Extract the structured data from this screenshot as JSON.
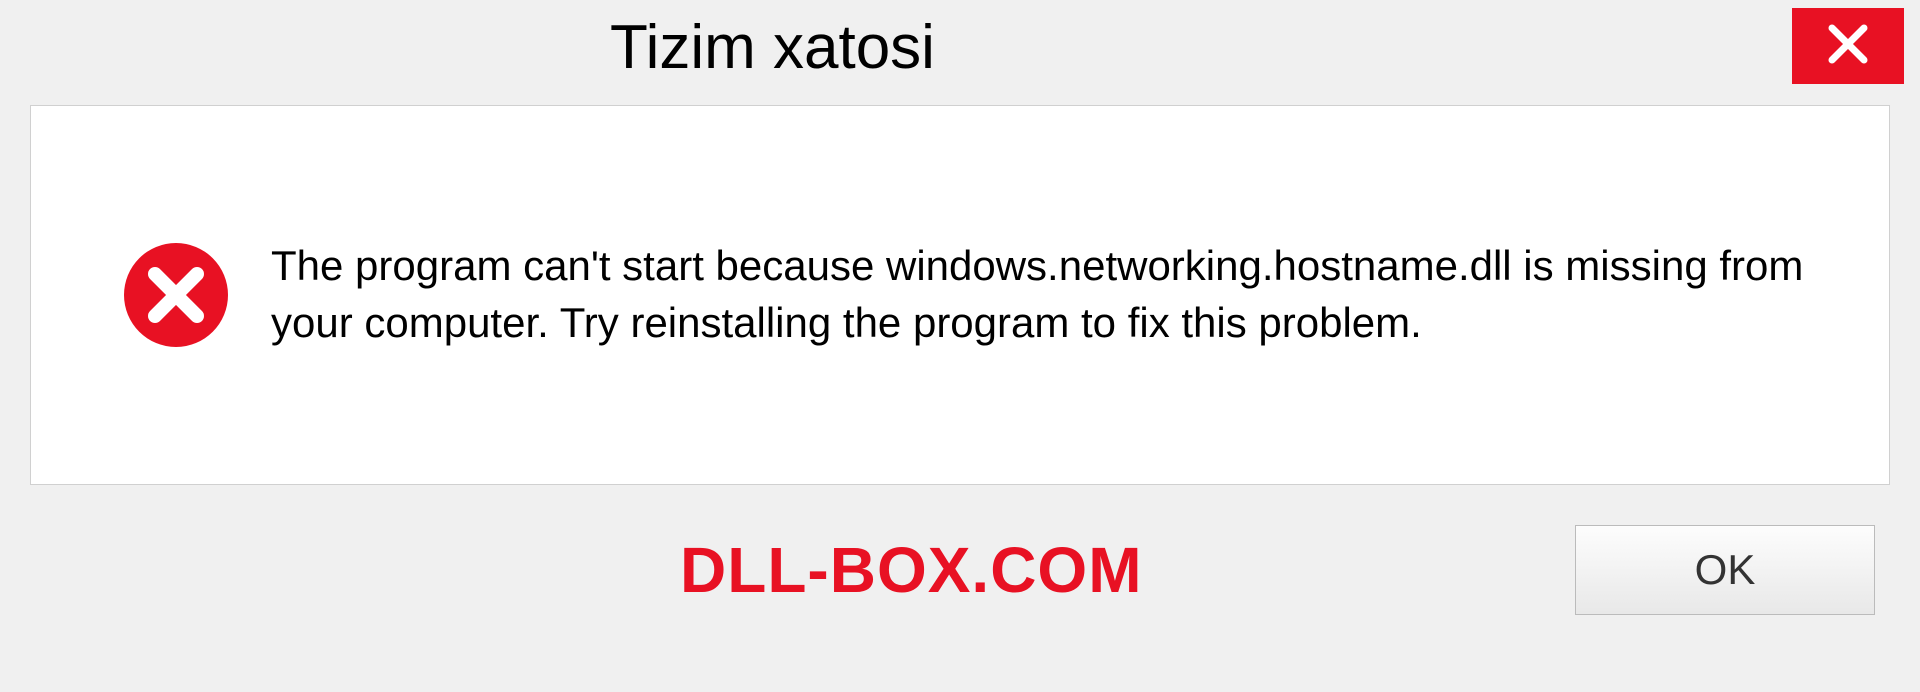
{
  "dialog": {
    "title": "Tizim xatosi",
    "message": "The program can't start because windows.networking.hostname.dll is missing from your computer. Try reinstalling the program to fix this problem.",
    "ok_label": "OK",
    "watermark": "DLL-BOX.COM"
  }
}
